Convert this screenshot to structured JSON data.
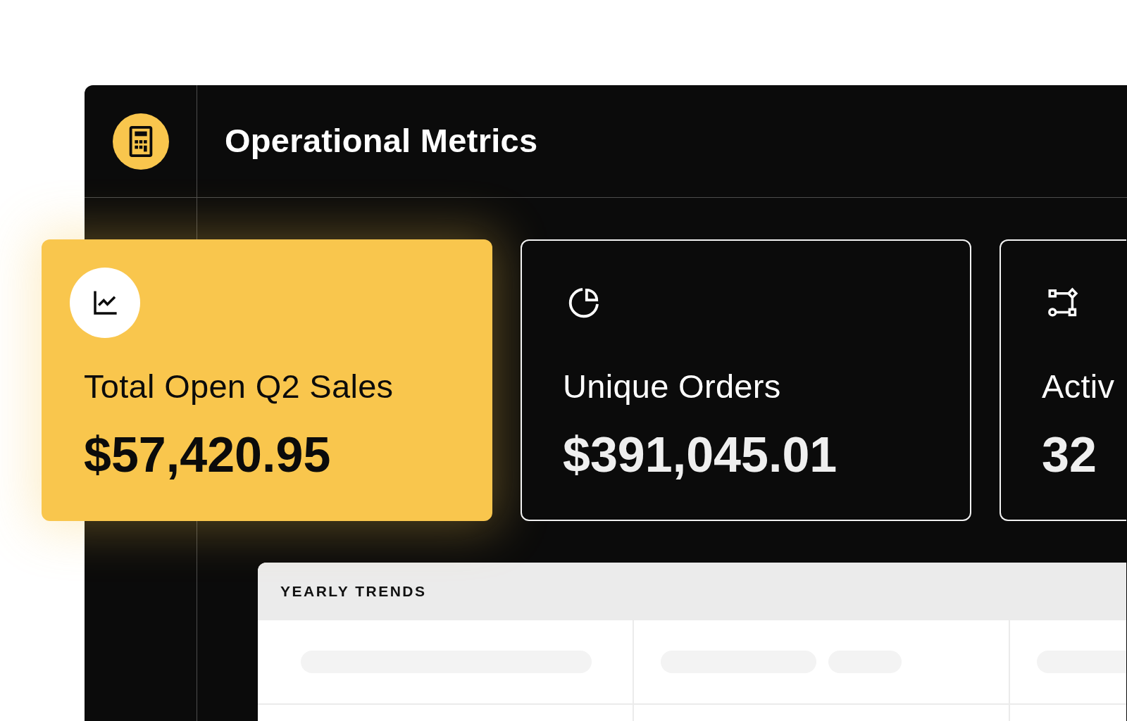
{
  "header": {
    "title": "Operational Metrics"
  },
  "metrics": [
    {
      "label": "Total Open Q2 Sales",
      "value": "$57,420.95",
      "selected": true
    },
    {
      "label": "Unique Orders",
      "value": "$391,045.01",
      "selected": false
    },
    {
      "label": "Activ",
      "value": "32",
      "selected": false
    }
  ],
  "yearly_trends": {
    "title": "YEARLY TRENDS",
    "loading": true
  }
}
